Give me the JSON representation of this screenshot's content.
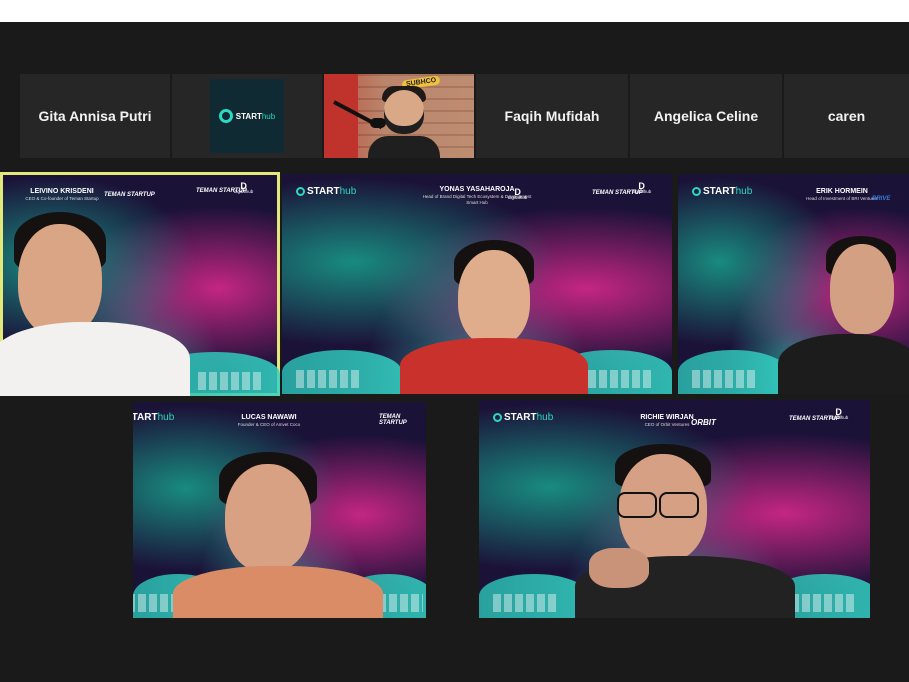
{
  "strip": {
    "participants": [
      {
        "name": "Gita Annisa Putri"
      },
      {
        "logo_text": "START",
        "logo_suffix": "hub"
      },
      {
        "sign_text": "SUBHCO"
      },
      {
        "name": "Faqih Mufidah"
      },
      {
        "name": "Angelica Celine"
      },
      {
        "name": "caren"
      }
    ]
  },
  "grid": {
    "tiles": [
      {
        "speaker_name": "LEIVINO KRISDENI",
        "speaker_role": "CEO & Co-founder of Teman Startup",
        "partner": "TEMAN STARTUP",
        "active": true
      },
      {
        "speaker_name": "YONAS YASAHAROJA",
        "speaker_role": "Head of Brand Digital Tech Ecosystem & Development Smart Hub",
        "active": false
      },
      {
        "speaker_name": "ERIK HORMEIN",
        "speaker_role": "Head of Investment of BRI Ventures",
        "partner": "BRIVE",
        "active": false
      },
      {
        "speaker_name": "LUCAS NAWAWI",
        "speaker_role": "Founder & CEO of Amvet Coco",
        "active": false
      },
      {
        "speaker_name": "RICHIE WIRJAN",
        "speaker_role": "CEO of Orbit Ventures",
        "partner": "ORBIT",
        "active": false
      }
    ],
    "brand": {
      "start": "START",
      "hub": "hub"
    },
    "teman": "TEMAN STARTUP",
    "digitalhub": {
      "letter": "D",
      "label": "digitalhub"
    }
  },
  "colors": {
    "active_outline": "#e3e87a",
    "teal": "#2fd6c0",
    "magenta": "#d6288c",
    "background": "#1a1a1a"
  }
}
